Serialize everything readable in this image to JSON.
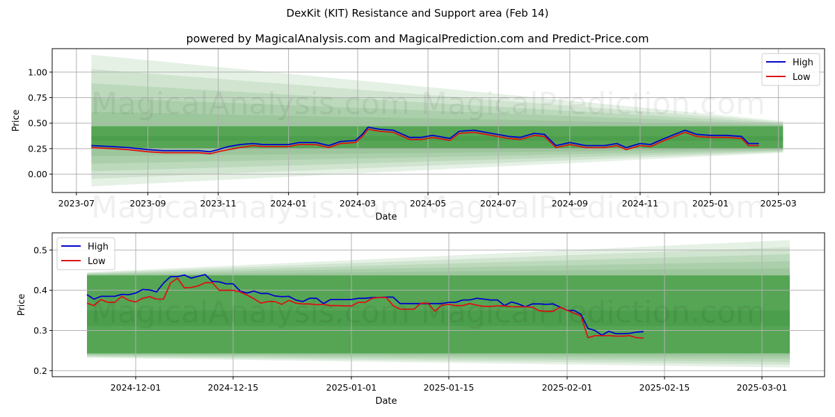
{
  "header": {
    "title": "DexKit (KIT) Resistance and Support area (Feb 14)",
    "subtitle": "powered by MagicalAnalysis.com and MagicalPrediction.com and Predict-Price.com"
  },
  "watermarks": [
    "MagicalAnalysis.com",
    "MagicalPrediction.com"
  ],
  "colors": {
    "high": "#0000cc",
    "low": "#dd1111",
    "band_dark": "#3d9a3d",
    "band_light": "#d4ead4",
    "grid": "#b0b0b0"
  },
  "chart_data": [
    {
      "type": "line",
      "title": "",
      "xlabel": "Date",
      "ylabel": "Price",
      "x_ticks": [
        "2023-07",
        "2023-09",
        "2023-11",
        "2024-01",
        "2024-03",
        "2024-05",
        "2024-07",
        "2024-09",
        "2024-11",
        "2025-01",
        "2025-03"
      ],
      "y_ticks": [
        "0.00",
        "0.25",
        "0.50",
        "0.75",
        "1.00"
      ],
      "ylim": [
        -0.18,
        1.23
      ],
      "xlim": [
        "2023-06-10",
        "2025-04-10"
      ],
      "grid": true,
      "legend": {
        "position": "top-right",
        "entries": [
          "High",
          "Low"
        ]
      },
      "support_resistance_band": {
        "start": "2023-07-14",
        "end": "2025-03-05",
        "inner_upper": 0.47,
        "inner_lower": 0.25,
        "outer_upper_start": 1.17,
        "outer_upper_end": 0.52,
        "outer_lower_start": -0.12,
        "outer_lower_end": 0.21
      },
      "x": [
        "2023-07-14",
        "2023-08-01",
        "2023-08-15",
        "2023-09-01",
        "2023-09-15",
        "2023-10-01",
        "2023-10-15",
        "2023-10-25",
        "2023-11-01",
        "2023-11-10",
        "2023-11-20",
        "2023-12-01",
        "2023-12-10",
        "2023-12-20",
        "2024-01-01",
        "2024-01-10",
        "2024-01-25",
        "2024-02-05",
        "2024-02-15",
        "2024-02-28",
        "2024-03-05",
        "2024-03-10",
        "2024-03-20",
        "2024-04-01",
        "2024-04-15",
        "2024-04-25",
        "2024-05-05",
        "2024-05-20",
        "2024-05-28",
        "2024-06-10",
        "2024-06-25",
        "2024-07-10",
        "2024-07-20",
        "2024-08-01",
        "2024-08-10",
        "2024-08-20",
        "2024-09-01",
        "2024-09-15",
        "2024-10-01",
        "2024-10-12",
        "2024-10-20",
        "2024-11-01",
        "2024-11-10",
        "2024-11-20",
        "2024-12-01",
        "2024-12-10",
        "2024-12-20",
        "2025-01-01",
        "2025-01-15",
        "2025-01-28",
        "2025-02-03",
        "2025-02-12"
      ],
      "series": [
        {
          "name": "High",
          "values": [
            0.28,
            0.27,
            0.26,
            0.24,
            0.23,
            0.23,
            0.23,
            0.22,
            0.24,
            0.27,
            0.29,
            0.3,
            0.29,
            0.29,
            0.29,
            0.31,
            0.31,
            0.28,
            0.32,
            0.33,
            0.39,
            0.46,
            0.44,
            0.43,
            0.36,
            0.36,
            0.38,
            0.35,
            0.42,
            0.43,
            0.4,
            0.37,
            0.36,
            0.4,
            0.39,
            0.28,
            0.31,
            0.28,
            0.28,
            0.3,
            0.26,
            0.3,
            0.29,
            0.34,
            0.39,
            0.43,
            0.39,
            0.38,
            0.38,
            0.37,
            0.3,
            0.3
          ]
        },
        {
          "name": "Low",
          "values": [
            0.26,
            0.25,
            0.24,
            0.22,
            0.21,
            0.21,
            0.21,
            0.2,
            0.22,
            0.24,
            0.26,
            0.28,
            0.27,
            0.27,
            0.27,
            0.29,
            0.29,
            0.26,
            0.3,
            0.31,
            0.37,
            0.44,
            0.42,
            0.41,
            0.34,
            0.34,
            0.36,
            0.33,
            0.4,
            0.41,
            0.38,
            0.35,
            0.34,
            0.38,
            0.37,
            0.26,
            0.29,
            0.26,
            0.26,
            0.28,
            0.24,
            0.28,
            0.27,
            0.32,
            0.37,
            0.41,
            0.37,
            0.36,
            0.36,
            0.35,
            0.28,
            0.28
          ]
        }
      ]
    },
    {
      "type": "line",
      "title": "",
      "xlabel": "Date",
      "ylabel": "Price",
      "x_ticks": [
        "2024-12-01",
        "2024-12-15",
        "2025-01-01",
        "2025-01-15",
        "2025-02-01",
        "2025-02-15",
        "2025-03-01"
      ],
      "y_ticks": [
        "0.2",
        "0.3",
        "0.4",
        "0.5"
      ],
      "ylim": [
        0.185,
        0.543
      ],
      "xlim": [
        "2024-11-19",
        "2025-03-10"
      ],
      "grid": true,
      "legend": {
        "position": "top-left",
        "entries": [
          "High",
          "Low"
        ]
      },
      "support_resistance_band": {
        "start": "2024-11-24",
        "end": "2025-03-05",
        "inner_upper": 0.437,
        "inner_lower": 0.243,
        "outer_upper_start": 0.445,
        "outer_upper_end": 0.525,
        "outer_lower_start": 0.232,
        "outer_lower_end": 0.208
      },
      "x": [
        "2024-11-24",
        "2024-11-25",
        "2024-11-26",
        "2024-11-27",
        "2024-11-28",
        "2024-11-29",
        "2024-11-30",
        "2024-12-01",
        "2024-12-02",
        "2024-12-03",
        "2024-12-04",
        "2024-12-05",
        "2024-12-06",
        "2024-12-07",
        "2024-12-08",
        "2024-12-09",
        "2024-12-10",
        "2024-12-11",
        "2024-12-12",
        "2024-12-13",
        "2024-12-14",
        "2024-12-15",
        "2024-12-16",
        "2024-12-17",
        "2024-12-18",
        "2024-12-19",
        "2024-12-20",
        "2024-12-21",
        "2024-12-22",
        "2024-12-23",
        "2024-12-24",
        "2024-12-25",
        "2024-12-26",
        "2024-12-27",
        "2024-12-28",
        "2024-12-29",
        "2024-12-30",
        "2024-12-31",
        "2025-01-01",
        "2025-01-02",
        "2025-01-03",
        "2025-01-04",
        "2025-01-05",
        "2025-01-06",
        "2025-01-07",
        "2025-01-08",
        "2025-01-09",
        "2025-01-10",
        "2025-01-11",
        "2025-01-12",
        "2025-01-13",
        "2025-01-14",
        "2025-01-15",
        "2025-01-16",
        "2025-01-17",
        "2025-01-18",
        "2025-01-19",
        "2025-01-20",
        "2025-01-21",
        "2025-01-22",
        "2025-01-23",
        "2025-01-24",
        "2025-01-25",
        "2025-01-26",
        "2025-01-27",
        "2025-01-28",
        "2025-01-29",
        "2025-01-30",
        "2025-01-31",
        "2025-02-01",
        "2025-02-02",
        "2025-02-03",
        "2025-02-04",
        "2025-02-05",
        "2025-02-06",
        "2025-02-07",
        "2025-02-08",
        "2025-02-09",
        "2025-02-10",
        "2025-02-11",
        "2025-02-12"
      ],
      "series": [
        {
          "name": "High",
          "values": [
            0.389,
            0.378,
            0.385,
            0.385,
            0.385,
            0.39,
            0.389,
            0.393,
            0.402,
            0.401,
            0.396,
            0.418,
            0.434,
            0.434,
            0.438,
            0.43,
            0.435,
            0.439,
            0.422,
            0.421,
            0.416,
            0.416,
            0.398,
            0.393,
            0.398,
            0.392,
            0.392,
            0.386,
            0.384,
            0.385,
            0.376,
            0.372,
            0.38,
            0.38,
            0.367,
            0.377,
            0.377,
            0.377,
            0.377,
            0.38,
            0.38,
            0.382,
            0.382,
            0.383,
            0.383,
            0.367,
            0.367,
            0.367,
            0.367,
            0.367,
            0.367,
            0.367,
            0.37,
            0.37,
            0.376,
            0.376,
            0.38,
            0.378,
            0.376,
            0.376,
            0.362,
            0.371,
            0.366,
            0.359,
            0.366,
            0.366,
            0.365,
            0.366,
            0.358,
            0.35,
            0.35,
            0.34,
            0.305,
            0.3,
            0.288,
            0.298,
            0.292,
            0.292,
            0.293,
            0.296,
            0.297
          ]
        },
        {
          "name": "Low",
          "values": [
            0.368,
            0.362,
            0.377,
            0.37,
            0.37,
            0.385,
            0.375,
            0.371,
            0.38,
            0.384,
            0.378,
            0.378,
            0.418,
            0.43,
            0.406,
            0.407,
            0.411,
            0.419,
            0.419,
            0.4,
            0.4,
            0.4,
            0.396,
            0.388,
            0.379,
            0.368,
            0.372,
            0.372,
            0.365,
            0.375,
            0.368,
            0.366,
            0.366,
            0.364,
            0.365,
            0.362,
            0.362,
            0.361,
            0.361,
            0.37,
            0.37,
            0.38,
            0.382,
            0.382,
            0.362,
            0.353,
            0.353,
            0.353,
            0.368,
            0.368,
            0.348,
            0.363,
            0.365,
            0.362,
            0.362,
            0.367,
            0.363,
            0.36,
            0.36,
            0.361,
            0.361,
            0.359,
            0.359,
            0.359,
            0.358,
            0.349,
            0.348,
            0.348,
            0.358,
            0.35,
            0.343,
            0.336,
            0.282,
            0.287,
            0.287,
            0.287,
            0.286,
            0.286,
            0.287,
            0.282,
            0.281
          ]
        }
      ]
    }
  ]
}
